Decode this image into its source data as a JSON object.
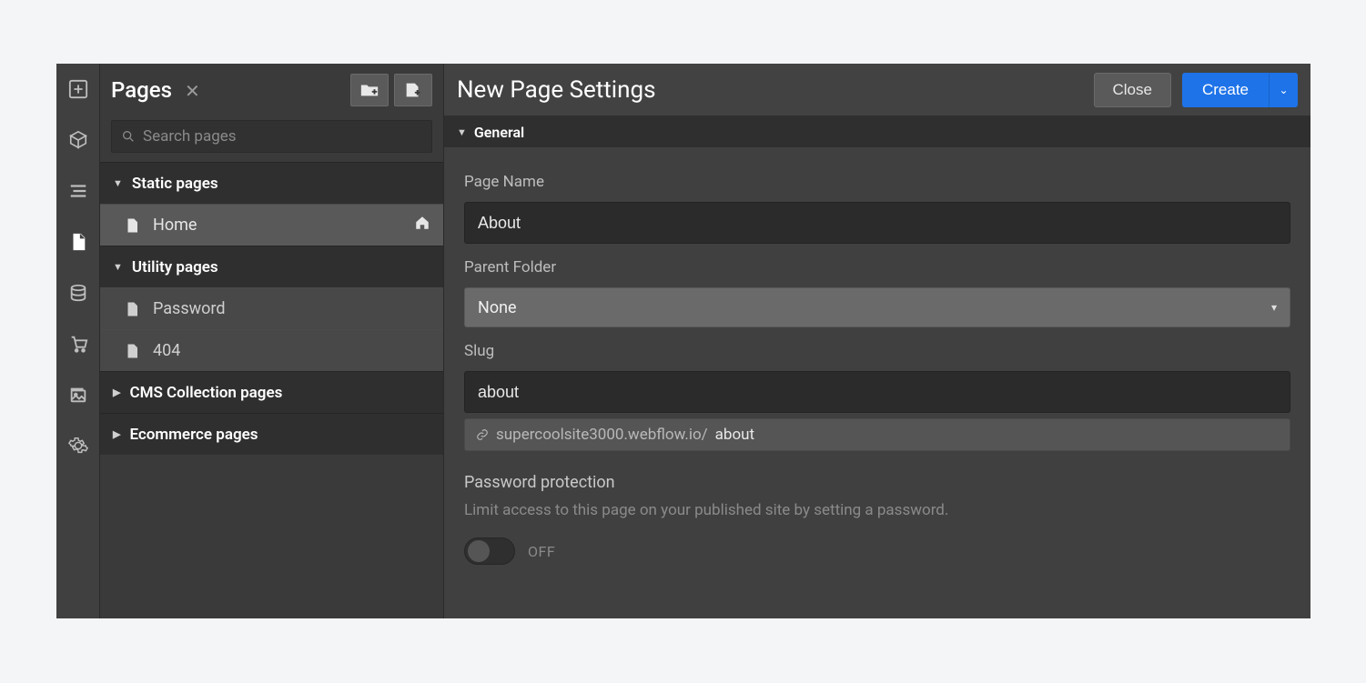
{
  "pages_panel": {
    "title": "Pages",
    "search_placeholder": "Search pages",
    "sections": [
      {
        "label": "Static pages",
        "open": true,
        "items": [
          {
            "label": "Home",
            "is_home": true
          }
        ]
      },
      {
        "label": "Utility pages",
        "open": true,
        "items": [
          {
            "label": "Password"
          },
          {
            "label": "404"
          }
        ]
      },
      {
        "label": "CMS Collection pages",
        "open": false,
        "items": []
      },
      {
        "label": "Ecommerce pages",
        "open": false,
        "items": []
      }
    ]
  },
  "settings": {
    "title": "New Page Settings",
    "close_label": "Close",
    "create_label": "Create",
    "section_general": "General",
    "fields": {
      "page_name_label": "Page Name",
      "page_name_value": "About",
      "parent_folder_label": "Parent Folder",
      "parent_folder_value": "None",
      "slug_label": "Slug",
      "slug_value": "about",
      "url_prefix": "supercoolsite3000.webflow.io/",
      "url_slug": "about",
      "pw_title": "Password protection",
      "pw_sub": "Limit access to this page on your published site by setting a password.",
      "pw_state": "OFF"
    }
  }
}
